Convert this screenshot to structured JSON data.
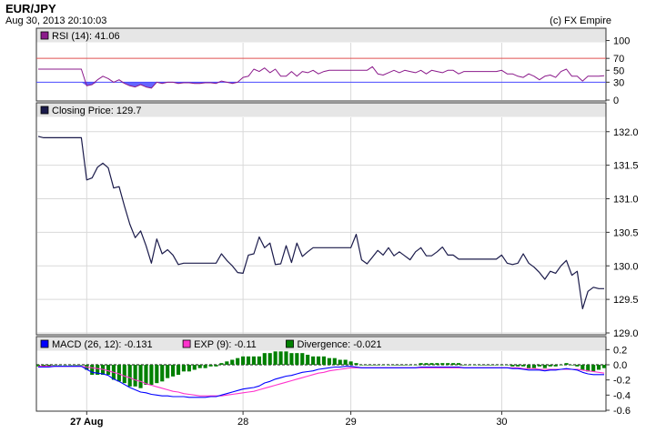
{
  "header": {
    "title": "EUR/JPY",
    "timestamp": "Aug 30, 2013 20:10:03",
    "credit": "(c) FX Empire"
  },
  "colors": {
    "price_line": "#1a1a4a",
    "rsi_line": "#8b1a8b",
    "rsi_fill": "#4a4aff",
    "rsi_70": "#e05050",
    "rsi_30": "#4a4aff",
    "macd": "#0000ff",
    "exp": "#ff33cc",
    "divergence": "#008000",
    "legend_bar": "#e6e6e6",
    "grid": "#d9d9d9"
  },
  "chart_data": [
    {
      "type": "line",
      "name": "rsi_panel",
      "legend": [
        {
          "label": "RSI (14): 41.06",
          "color": "#8b1a8b"
        }
      ],
      "yticks": [
        "100",
        "70",
        "50",
        "30",
        "0"
      ],
      "ylim": [
        0,
        110
      ],
      "levels": [
        70,
        30
      ],
      "series": [
        {
          "name": "RSI (14)",
          "x": [
            0,
            1,
            2,
            3,
            4,
            5,
            6,
            7,
            8,
            9,
            10,
            11,
            12,
            13,
            14,
            15,
            16,
            17,
            18,
            19,
            20,
            21,
            22,
            23,
            24,
            25,
            26,
            27,
            28,
            29,
            30,
            31,
            32,
            33,
            34,
            35,
            36,
            37,
            38,
            39,
            40,
            41,
            42,
            43,
            44,
            45,
            46,
            47,
            48,
            49,
            50,
            51,
            52,
            53,
            54,
            55,
            56,
            57,
            58,
            59,
            60,
            61,
            62,
            63,
            64,
            65,
            66,
            67,
            68,
            69,
            70,
            71,
            72,
            73,
            74,
            75,
            76,
            77,
            78,
            79,
            80,
            81,
            82,
            83,
            84,
            85,
            86,
            87,
            88,
            89,
            90,
            91,
            92,
            93,
            94,
            95,
            96,
            97,
            98,
            99,
            100,
            101,
            102,
            103,
            104,
            105
          ],
          "values": [
            52,
            52,
            52,
            52,
            52,
            52,
            52,
            52,
            52,
            24,
            26,
            34,
            40,
            36,
            30,
            34,
            28,
            24,
            22,
            26,
            22,
            20,
            30,
            28,
            30,
            30,
            28,
            29,
            29,
            28,
            28,
            29,
            29,
            28,
            32,
            30,
            28,
            30,
            38,
            40,
            52,
            48,
            54,
            46,
            52,
            40,
            40,
            48,
            40,
            48,
            46,
            50,
            44,
            48,
            50,
            50,
            50,
            50,
            50,
            50,
            50,
            50,
            56,
            44,
            42,
            46,
            50,
            46,
            50,
            48,
            46,
            50,
            44,
            50,
            48,
            46,
            50,
            50,
            44,
            48,
            48,
            48,
            48,
            48,
            48,
            48,
            50,
            44,
            44,
            40,
            38,
            44,
            40,
            34,
            40,
            42,
            38,
            48,
            52,
            40,
            40,
            32,
            40,
            40,
            40,
            41
          ]
        }
      ]
    },
    {
      "type": "line",
      "name": "price_panel",
      "legend": [
        {
          "label": "Closing Price: 129.7",
          "color": "#1a1a4a"
        }
      ],
      "yticks": [
        "132.0",
        "131.5",
        "131.0",
        "130.5",
        "130.0",
        "129.5",
        "129.0"
      ],
      "ylim": [
        129.0,
        132.2
      ],
      "series": [
        {
          "name": "Closing Price",
          "x": [
            0,
            1,
            2,
            3,
            4,
            5,
            6,
            7,
            8,
            9,
            10,
            11,
            12,
            13,
            14,
            15,
            16,
            17,
            18,
            19,
            20,
            21,
            22,
            23,
            24,
            25,
            26,
            27,
            28,
            29,
            30,
            31,
            32,
            33,
            34,
            35,
            36,
            37,
            38,
            39,
            40,
            41,
            42,
            43,
            44,
            45,
            46,
            47,
            48,
            49,
            50,
            51,
            52,
            53,
            54,
            55,
            56,
            57,
            58,
            59,
            60,
            61,
            62,
            63,
            64,
            65,
            66,
            67,
            68,
            69,
            70,
            71,
            72,
            73,
            74,
            75,
            76,
            77,
            78,
            79,
            80,
            81,
            82,
            83,
            84,
            85,
            86,
            87,
            88,
            89,
            90,
            91,
            92,
            93,
            94,
            95,
            96,
            97,
            98,
            99,
            100,
            101,
            102,
            103,
            104,
            105
          ],
          "values": [
            131.93,
            131.91,
            131.91,
            131.91,
            131.91,
            131.91,
            131.91,
            131.91,
            131.91,
            131.28,
            131.31,
            131.47,
            131.53,
            131.46,
            131.16,
            131.18,
            130.89,
            130.62,
            130.42,
            130.52,
            130.3,
            130.04,
            130.4,
            130.18,
            130.24,
            130.16,
            130.02,
            130.04,
            130.04,
            130.04,
            130.04,
            130.04,
            130.04,
            130.04,
            130.18,
            130.08,
            130.0,
            129.9,
            129.89,
            130.16,
            130.18,
            130.43,
            130.27,
            130.34,
            130.02,
            130.03,
            130.3,
            130.05,
            130.34,
            130.14,
            130.21,
            130.27,
            130.27,
            130.27,
            130.27,
            130.27,
            130.27,
            130.27,
            130.27,
            130.47,
            130.09,
            130.03,
            130.13,
            130.23,
            130.16,
            130.27,
            130.15,
            130.21,
            130.15,
            130.09,
            130.21,
            130.27,
            130.15,
            130.15,
            130.21,
            130.28,
            130.16,
            130.16,
            130.1,
            130.1,
            130.1,
            130.1,
            130.1,
            130.1,
            130.1,
            130.1,
            130.16,
            130.04,
            130.02,
            130.04,
            130.18,
            130.04,
            129.98,
            129.9,
            129.8,
            129.92,
            129.89,
            130.0,
            130.08,
            129.86,
            129.92,
            129.36,
            129.62,
            129.68,
            129.66,
            129.66
          ]
        }
      ]
    },
    {
      "type": "line",
      "name": "macd_panel",
      "legend": [
        {
          "label": "MACD (26, 12): -0.131",
          "color": "#0000ff"
        },
        {
          "label": "EXP (9): -0.11",
          "color": "#ff33cc"
        },
        {
          "label": "Divergence: -0.021",
          "color": "#008000"
        }
      ],
      "yticks": [
        "0.2",
        "0.0",
        "-0.2",
        "-0.4",
        "-0.6"
      ],
      "ylim": [
        -0.6,
        0.3
      ],
      "xlabels": [
        {
          "text": "27 Aug",
          "bold": true,
          "index": 9
        },
        {
          "text": "28",
          "bold": false,
          "index": 38
        },
        {
          "text": "29",
          "bold": false,
          "index": 58
        },
        {
          "text": "30",
          "bold": false,
          "index": 86
        }
      ],
      "series": [
        {
          "name": "MACD",
          "values": [
            -0.03,
            -0.03,
            -0.03,
            -0.02,
            -0.02,
            -0.02,
            -0.02,
            -0.02,
            -0.02,
            -0.06,
            -0.1,
            -0.11,
            -0.12,
            -0.14,
            -0.19,
            -0.22,
            -0.26,
            -0.3,
            -0.33,
            -0.36,
            -0.37,
            -0.39,
            -0.4,
            -0.41,
            -0.41,
            -0.42,
            -0.42,
            -0.42,
            -0.43,
            -0.43,
            -0.43,
            -0.43,
            -0.42,
            -0.42,
            -0.4,
            -0.38,
            -0.36,
            -0.34,
            -0.32,
            -0.31,
            -0.3,
            -0.28,
            -0.24,
            -0.22,
            -0.19,
            -0.17,
            -0.15,
            -0.14,
            -0.12,
            -0.1,
            -0.09,
            -0.08,
            -0.06,
            -0.05,
            -0.04,
            -0.03,
            -0.03,
            -0.02,
            -0.02,
            -0.03,
            -0.04,
            -0.04,
            -0.04,
            -0.04,
            -0.04,
            -0.04,
            -0.04,
            -0.04,
            -0.04,
            -0.04,
            -0.04,
            -0.03,
            -0.03,
            -0.03,
            -0.03,
            -0.03,
            -0.03,
            -0.03,
            -0.03,
            -0.04,
            -0.04,
            -0.04,
            -0.04,
            -0.04,
            -0.04,
            -0.04,
            -0.04,
            -0.04,
            -0.05,
            -0.05,
            -0.06,
            -0.07,
            -0.07,
            -0.07,
            -0.08,
            -0.07,
            -0.07,
            -0.06,
            -0.05,
            -0.06,
            -0.07,
            -0.1,
            -0.12,
            -0.13,
            -0.13,
            -0.13
          ]
        },
        {
          "name": "EXP",
          "values": [
            -0.02,
            -0.02,
            -0.02,
            -0.02,
            -0.02,
            -0.02,
            -0.02,
            -0.02,
            -0.02,
            -0.03,
            -0.04,
            -0.05,
            -0.06,
            -0.08,
            -0.1,
            -0.12,
            -0.15,
            -0.17,
            -0.2,
            -0.22,
            -0.25,
            -0.27,
            -0.29,
            -0.31,
            -0.33,
            -0.35,
            -0.36,
            -0.38,
            -0.39,
            -0.4,
            -0.41,
            -0.41,
            -0.41,
            -0.41,
            -0.41,
            -0.4,
            -0.39,
            -0.38,
            -0.37,
            -0.36,
            -0.35,
            -0.33,
            -0.31,
            -0.29,
            -0.27,
            -0.25,
            -0.23,
            -0.21,
            -0.19,
            -0.17,
            -0.15,
            -0.13,
            -0.11,
            -0.1,
            -0.08,
            -0.07,
            -0.06,
            -0.05,
            -0.04,
            -0.04,
            -0.04,
            -0.04,
            -0.04,
            -0.04,
            -0.04,
            -0.04,
            -0.04,
            -0.04,
            -0.04,
            -0.04,
            -0.04,
            -0.04,
            -0.04,
            -0.04,
            -0.04,
            -0.04,
            -0.04,
            -0.04,
            -0.04,
            -0.04,
            -0.04,
            -0.04,
            -0.04,
            -0.04,
            -0.04,
            -0.04,
            -0.04,
            -0.04,
            -0.04,
            -0.04,
            -0.05,
            -0.05,
            -0.05,
            -0.06,
            -0.06,
            -0.06,
            -0.06,
            -0.06,
            -0.06,
            -0.06,
            -0.06,
            -0.07,
            -0.08,
            -0.09,
            -0.1,
            -0.11
          ]
        }
      ]
    }
  ]
}
